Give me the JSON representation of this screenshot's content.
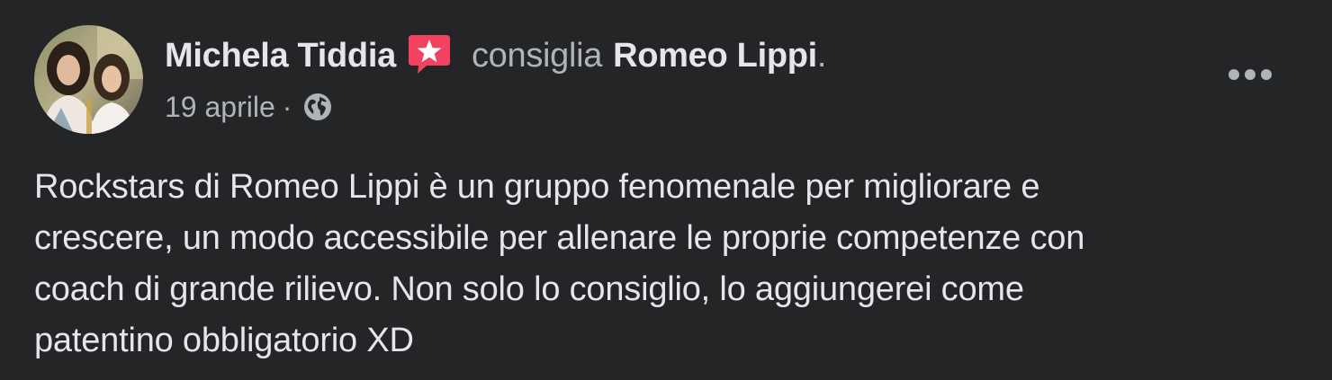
{
  "post": {
    "author_name": "Michela Tiddia",
    "action_text": "consiglia",
    "page_name": "Romeo Lippi",
    "page_period": ".",
    "timestamp": "19 aprile",
    "separator": "·",
    "privacy_icon": "globe-icon",
    "recommend_icon": "recommend-star-icon",
    "more_icon": "more-options-icon",
    "text_lines": [
      "Rockstars di Romeo Lippi è un gruppo fenomenale per migliorare e",
      "crescere, un modo accessibile per allenare le proprie competenze con",
      "coach di grande rilievo. Non solo lo consiglio, lo aggiungerei come",
      "patentino obbligatorio XD"
    ]
  },
  "colors": {
    "background": "#242526",
    "primary_text": "#e4e6eb",
    "secondary_text": "#b0b3b8",
    "recommend_badge": "#f3425f"
  }
}
